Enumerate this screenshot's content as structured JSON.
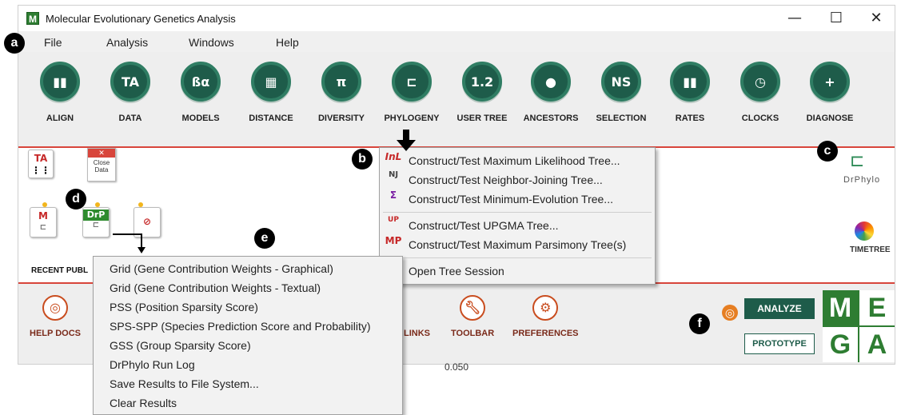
{
  "window": {
    "title": "Molecular Evolutionary Genetics Analysis",
    "app_icon": "M",
    "minimize": "—",
    "maximize": "☐",
    "close": "✕"
  },
  "menu": [
    "File",
    "Analysis",
    "Windows",
    "Help"
  ],
  "toolbar": [
    {
      "label": "ALIGN",
      "icon": "align-icon",
      "glyph": "▮▮"
    },
    {
      "label": "DATA",
      "icon": "data-icon",
      "glyph": "TA"
    },
    {
      "label": "MODELS",
      "icon": "models-icon",
      "glyph": "ßα"
    },
    {
      "label": "DISTANCE",
      "icon": "distance-icon",
      "glyph": "▦"
    },
    {
      "label": "DIVERSITY",
      "icon": "diversity-icon",
      "glyph": "π"
    },
    {
      "label": "PHYLOGENY",
      "icon": "phylogeny-icon",
      "glyph": "⊏"
    },
    {
      "label": "USER TREE",
      "icon": "user-tree-icon",
      "glyph": "1.2"
    },
    {
      "label": "ANCESTORS",
      "icon": "ancestors-icon",
      "glyph": "●"
    },
    {
      "label": "SELECTION",
      "icon": "selection-icon",
      "glyph": "NS"
    },
    {
      "label": "RATES",
      "icon": "rates-icon",
      "glyph": "▮▮"
    },
    {
      "label": "CLOCKS",
      "icon": "clocks-icon",
      "glyph": "◷"
    },
    {
      "label": "DIAGNOSE",
      "icon": "diagnose-icon",
      "glyph": "+"
    }
  ],
  "close_data": {
    "label": "Close Data",
    "x": "✕"
  },
  "ta_icon": "TA",
  "recent_label": "RECENT PUBL",
  "phylogeny_menu": [
    {
      "icon": "InL",
      "label": "Construct/Test Maximum Likelihood Tree..."
    },
    {
      "icon": "NJ",
      "label": "Construct/Test Neighbor-Joining Tree..."
    },
    {
      "icon": "Σ",
      "label": "Construct/Test Minimum-Evolution Tree..."
    },
    {
      "icon": "UP",
      "label": "Construct/Test UPGMA Tree..."
    },
    {
      "icon": "MP",
      "label": "Construct/Test Maximum Parsimony Tree(s)"
    },
    {
      "icon": "▬",
      "label": "Open Tree Session"
    }
  ],
  "drphylo_menu": [
    "Grid (Gene Contribution Weights - Graphical)",
    "Grid (Gene Contribution Weights - Textual)",
    "PSS (Position Sparsity Score)",
    "SPS-SPP (Species Prediction Score and Probability)",
    "GSS (Group Sparsity Score)",
    "DrPhylo Run Log",
    "Save Results to File System...",
    "Clear Results"
  ],
  "bottom": [
    {
      "label": "HELP DOCS",
      "icon": "help-docs-icon"
    },
    {
      "label": "LINKS",
      "icon": "links-icon"
    },
    {
      "label": "TOOLBAR",
      "icon": "toolbar-icon"
    },
    {
      "label": "PREFERENCES",
      "icon": "preferences-icon"
    }
  ],
  "analyze_label": "ANALYZE",
  "prototype_label": "PROTOTYPE",
  "drphylo_logo": "DrPhylo",
  "timetree_logo": "TIMETREE",
  "mega_letters": [
    "M",
    "E",
    "G",
    "A"
  ],
  "callouts": [
    "a",
    "b",
    "c",
    "d",
    "e",
    "f"
  ],
  "doc_icons": [
    "M",
    "DrP"
  ],
  "behind_text": "0.050",
  "colors": {
    "toolbar_circle": "#1e5c4a",
    "accent_red": "#d8453b",
    "mega_green": "#2e7d32"
  }
}
